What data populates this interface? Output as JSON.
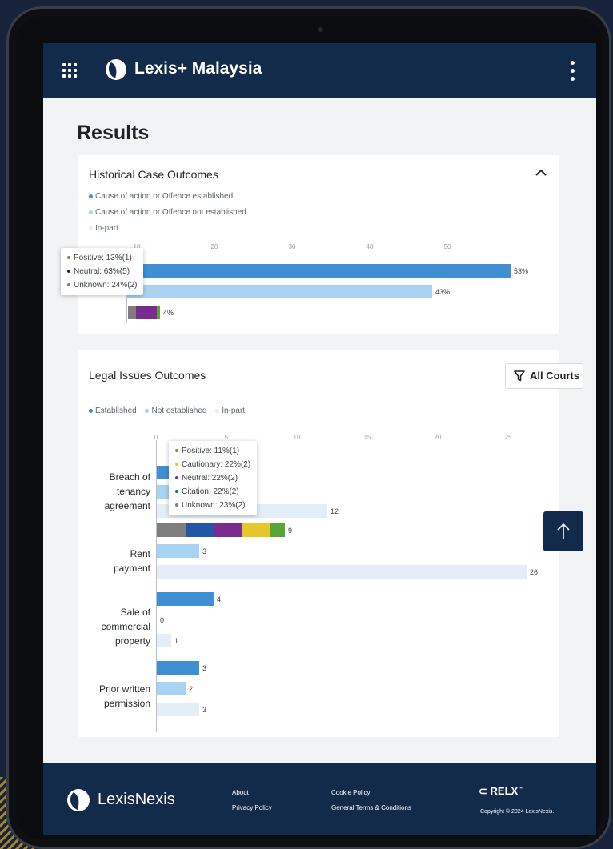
{
  "header": {
    "brand_name": "Lexis+ Malaysia",
    "menu_icon": "grid-icon",
    "kebab_icon": "more-vertical-icon"
  },
  "page": {
    "title": "Results"
  },
  "historical_card": {
    "title": "Historical Case Outcomes",
    "legend": [
      {
        "label": "Cause of action or Offence established",
        "color": "#3f8fd2"
      },
      {
        "label": "Cause of action or Offence not established",
        "color": "#a9d3f2"
      },
      {
        "label": "In-part",
        "color": "#e3eef8"
      }
    ],
    "tooltip": [
      {
        "label": "Positive: 13%(1)",
        "color": "#57a63a"
      },
      {
        "label": "Neutral: 63%(5)",
        "color": "#1f2a44"
      },
      {
        "label": "Unknown: 24%(2)",
        "color": "#7e7e7e"
      }
    ],
    "bar_labels": [
      "53%",
      "43%",
      "4%"
    ]
  },
  "legal_card": {
    "title": "Legal Issues Outcomes",
    "filter_label": "All Courts",
    "legend": [
      {
        "label": "Established",
        "color": "#3f8fd2"
      },
      {
        "label": "Not established",
        "color": "#a9d3f2"
      },
      {
        "label": "In-part",
        "color": "#e3eef8"
      }
    ],
    "categories": [
      {
        "l1": "Breach of",
        "l2": "tenancy",
        "l3": "agreement"
      },
      {
        "l1": "Rent",
        "l2": "payment",
        "l3": ""
      },
      {
        "l1": "Sale of",
        "l2": "commercial",
        "l3": "property"
      },
      {
        "l1": "Prior written",
        "l2": "permission",
        "l3": ""
      }
    ],
    "value_labels": {
      "breach_inpart": "12",
      "rent_established": "9",
      "rent_not_established": "3",
      "rent_inpart": "26",
      "sale_established": "4",
      "sale_not_established": "0",
      "sale_inpart": "1",
      "prior_established": "3",
      "prior_not_established": "2",
      "prior_inpart": "3"
    },
    "tooltip": [
      {
        "label": "Positive: 11%(1)",
        "color": "#57a63a"
      },
      {
        "label": "Cautionary: 22%(2)",
        "color": "#e6c729"
      },
      {
        "label": "Neutral: 22%(2)",
        "color": "#7a2c8e"
      },
      {
        "label": "Citation: 22%(2)",
        "color": "#2456a6"
      },
      {
        "label": "Unknown: 23%(2)",
        "color": "#7e7e7e"
      }
    ]
  },
  "chart_data": [
    {
      "type": "bar",
      "title": "Historical Case Outcomes",
      "categories": [
        "Cause of action or Offence established",
        "Cause of action or Offence not established",
        "In-part"
      ],
      "values": [
        53,
        43,
        4
      ],
      "unit": "%",
      "xlim": [
        0,
        60
      ]
    },
    {
      "type": "bar",
      "title": "Legal Issues Outcomes",
      "categories": [
        "Breach of tenancy agreement",
        "Rent payment",
        "Sale of commercial property",
        "Prior written permission"
      ],
      "series": [
        {
          "name": "Established",
          "values": [
            1,
            9,
            4,
            3
          ]
        },
        {
          "name": "Not established",
          "values": [
            1,
            3,
            0,
            2
          ]
        },
        {
          "name": "In-part",
          "values": [
            12,
            26,
            1,
            3
          ]
        }
      ],
      "xlim": [
        0,
        26
      ]
    }
  ],
  "colors": {
    "header_bg": "#132b4b",
    "established": "#3f8fd2",
    "not_established": "#a9d3f2",
    "in_part": "#e3eef8"
  },
  "footer": {
    "brand": "LexisNexis",
    "links": {
      "about": "About",
      "privacy": "Privacy Policy",
      "cookie": "Cookie Policy",
      "terms": "General Terms & Conditions"
    },
    "relx": "RELX",
    "copyright": "Copyright © 2024 LexisNexis."
  }
}
